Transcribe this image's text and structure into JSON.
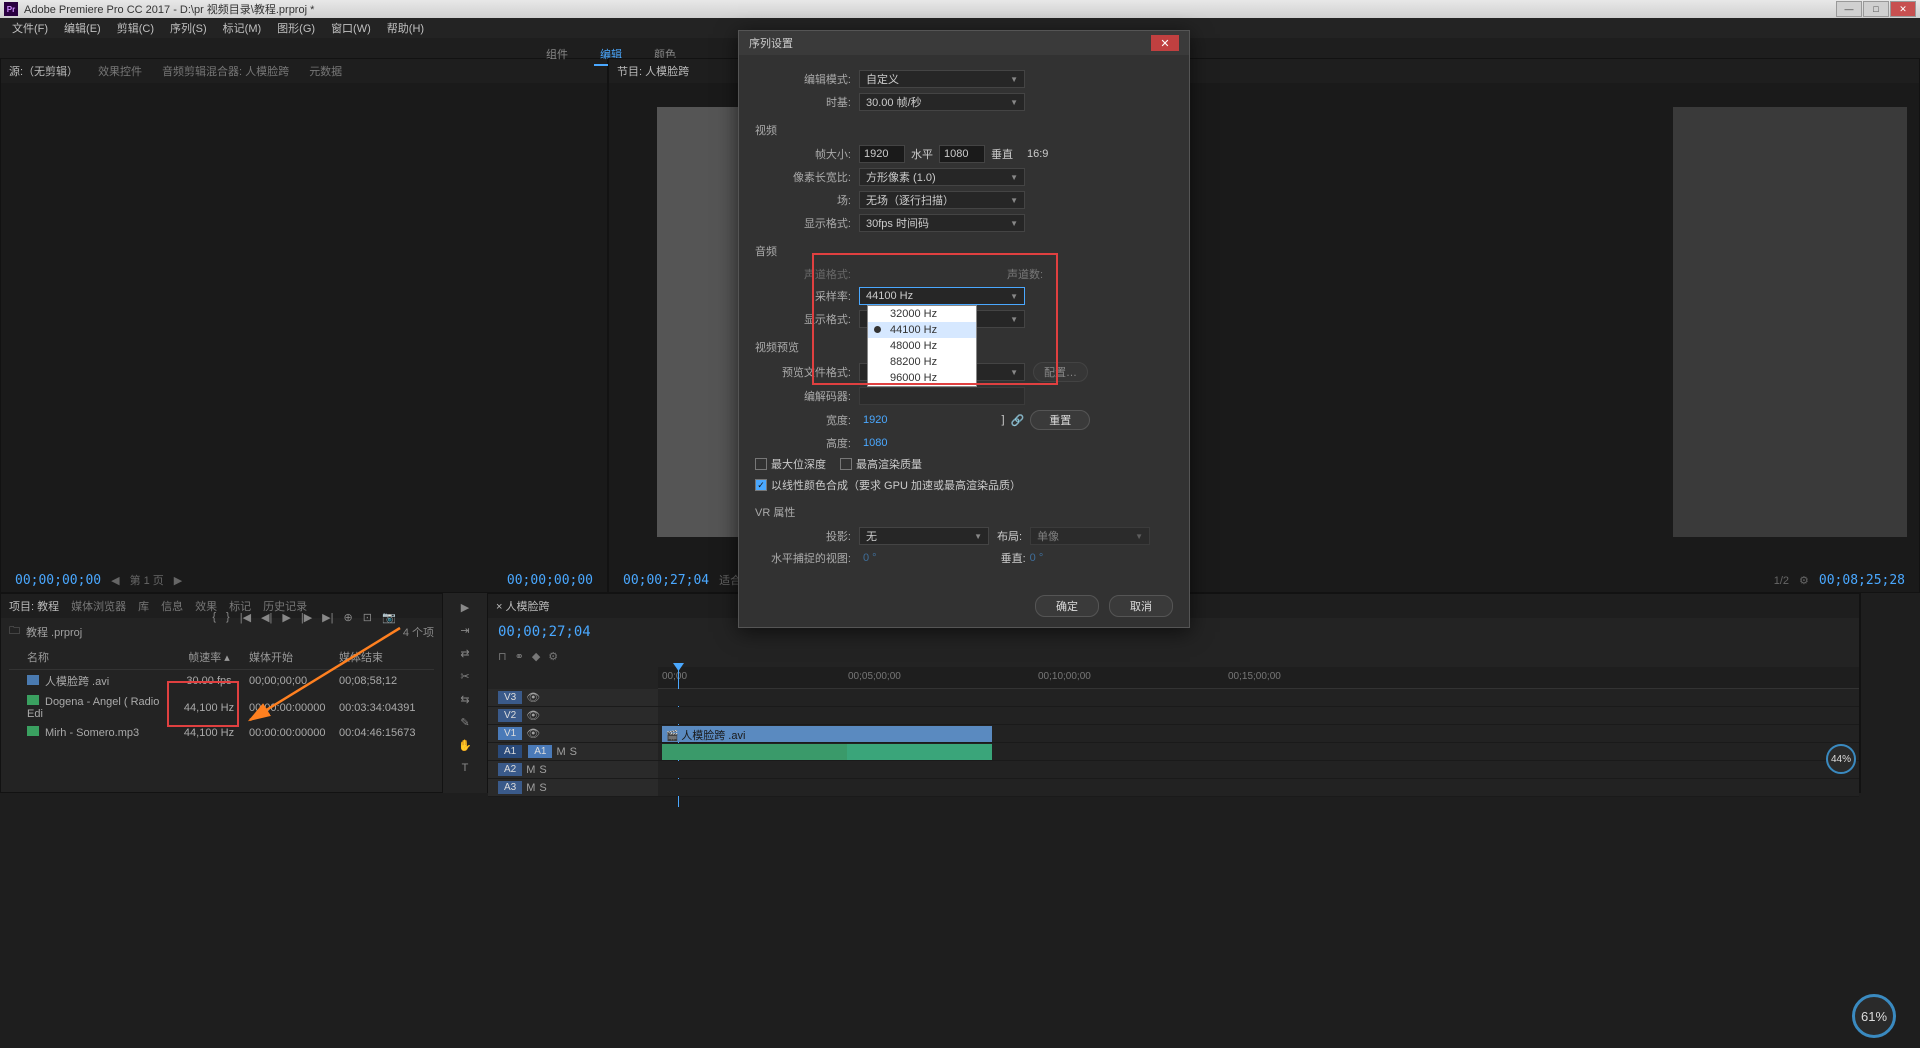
{
  "titlebar": {
    "app_badge": "Pr",
    "title": "Adobe Premiere Pro CC 2017 - D:\\pr 视频目录\\教程.prproj *"
  },
  "menubar": {
    "items": [
      "文件(F)",
      "编辑(E)",
      "剪辑(C)",
      "序列(S)",
      "标记(M)",
      "图形(G)",
      "窗口(W)",
      "帮助(H)"
    ]
  },
  "workspace": {
    "tabs": [
      "组件",
      "编辑",
      "颜色"
    ],
    "active_index": 1
  },
  "source_panel": {
    "tabs": [
      "源:（无剪辑）",
      "效果控件",
      "音频剪辑混合器: 人模脸跨",
      "元数据"
    ],
    "timecode": "00;00;00;00",
    "page_nav": "第 1 页",
    "right_tc": "00;00;00;00"
  },
  "program_panel": {
    "tab": "节目: 人模脸跨",
    "timecode": "00;00;27;04",
    "fit_label": "适合",
    "scale": "1/2",
    "duration": "00;08;25;28",
    "badge_pct": "44%"
  },
  "project_panel": {
    "tabs": [
      "项目: 教程",
      "媒体浏览器",
      "库",
      "信息",
      "效果",
      "标记",
      "历史记录"
    ],
    "bin_name": "教程 .prproj",
    "item_count": "4 个项",
    "columns": [
      "名称",
      "帧速率",
      "媒体开始",
      "媒体结束"
    ],
    "rows": [
      {
        "icon": "seq",
        "name": "人模脸跨 .avi",
        "fps": "30.00 fps",
        "start": "00;00;00;00",
        "end": "00;08;58;12"
      },
      {
        "icon": "audio",
        "name": "Dogena - Angel ( Radio Edi",
        "fps": "44,100 Hz",
        "start": "00:00:00:00000",
        "end": "00:03:34:04391"
      },
      {
        "icon": "audio",
        "name": "Mirh - Somero.mp3",
        "fps": "44,100 Hz",
        "start": "00:00:00:00000",
        "end": "00:04:46:15673"
      }
    ]
  },
  "timeline": {
    "sequence_name": "人模脸跨",
    "timecode": "00;00;27;04",
    "ruler": [
      "00;00",
      "00;05;00;00",
      "00;10;00;00",
      "00;15;00;00"
    ],
    "tracks": {
      "v3": "V3",
      "v2": "V2",
      "v1": "V1",
      "a1": "A1",
      "a2": "A2",
      "a3": "A3"
    },
    "clip_video": "人模脸跨 .avi"
  },
  "dialog": {
    "title": "序列设置",
    "edit_mode_label": "编辑模式:",
    "edit_mode_value": "自定义",
    "timebase_label": "时基:",
    "timebase_value": "30.00 帧/秒",
    "section_video": "视频",
    "frame_size_label": "帧大小:",
    "frame_w": "1920",
    "frame_h_label": "水平",
    "frame_h": "1080",
    "frame_v_label": "垂直",
    "aspect": "16:9",
    "pixel_aspect_label": "像素长宽比:",
    "pixel_aspect_value": "方形像素 (1.0)",
    "fields_label": "场:",
    "fields_value": "无场（逐行扫描）",
    "display_fmt_label": "显示格式:",
    "display_fmt_value": "30fps 时间码",
    "section_audio": "音频",
    "channel_fmt_label": "声道格式:",
    "channel_count_label": "声道数:",
    "sample_rate_label": "采样率:",
    "sample_rate_value": "44100 Hz",
    "sample_rate_options": [
      "32000 Hz",
      "44100 Hz",
      "48000 Hz",
      "88200 Hz",
      "96000 Hz"
    ],
    "sample_rate_selected_index": 1,
    "audio_display_label": "显示格式:",
    "section_preview": "视频预览",
    "preview_fmt_label": "预览文件格式:",
    "codec_label": "编解码器:",
    "config_btn": "配置…",
    "width_label": "宽度:",
    "width_value": "1920",
    "height_label": "高度:",
    "height_value": "1080",
    "reset_btn": "重置",
    "max_depth": "最大位深度",
    "max_quality": "最高渲染质量",
    "linear_color": "以线性颜色合成（要求 GPU 加速或最高渲染品质）",
    "section_vr": "VR 属性",
    "projection_label": "投影:",
    "projection_value": "无",
    "layout_label": "布局:",
    "layout_value": "单像",
    "horiz_capture_label": "水平捕捉的视图:",
    "horiz_capture_value": "0 °",
    "vert_label": "垂直:",
    "vert_value": "0 °",
    "ok": "确定",
    "cancel": "取消"
  },
  "perf": {
    "main_pct": "61%"
  }
}
